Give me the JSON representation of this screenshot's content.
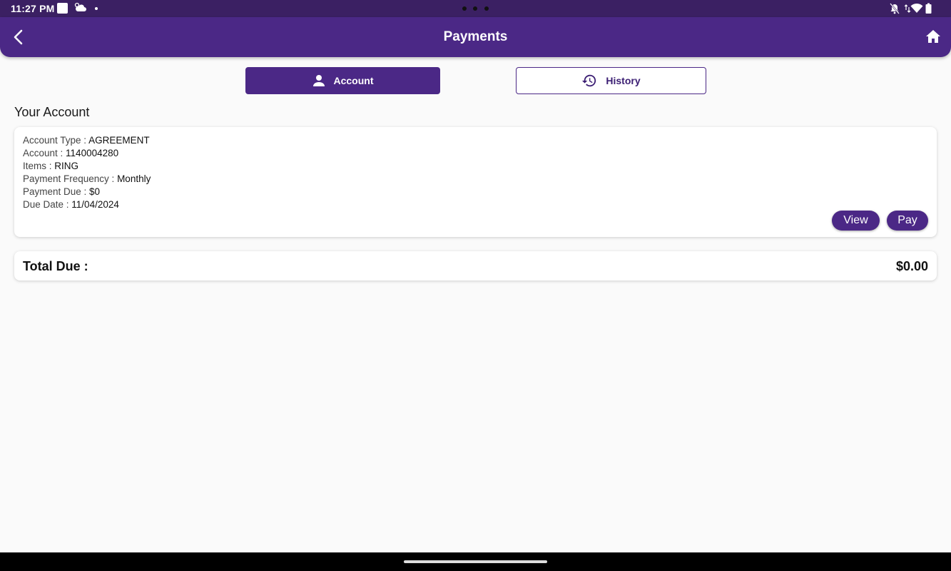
{
  "status_bar": {
    "time": "11:27 PM",
    "icons": [
      "notification-square-icon",
      "cloud-icon",
      "dot-icon",
      "camera-dots",
      "bell-off-icon",
      "data-arrows-icon",
      "wifi-icon",
      "battery-icon"
    ]
  },
  "app_bar": {
    "title": "Payments",
    "back_icon": "back-chevron-icon",
    "home_icon": "home-icon"
  },
  "tabs": [
    {
      "label": "Account",
      "icon": "person-icon",
      "selected": true
    },
    {
      "label": "History",
      "icon": "history-icon",
      "selected": false
    }
  ],
  "section_title": "Your Account",
  "account": {
    "rows": [
      {
        "label": "Account Type : ",
        "value": "AGREEMENT"
      },
      {
        "label": "Account : ",
        "value": "1140004280"
      },
      {
        "label": "Items : ",
        "value": "RING"
      },
      {
        "label": "Payment Frequency : ",
        "value": "Monthly"
      },
      {
        "label": "Payment Due : ",
        "value": "$0"
      },
      {
        "label": "Due Date : ",
        "value": "11/04/2024"
      }
    ],
    "view_label": "View",
    "pay_label": "Pay"
  },
  "total": {
    "label": "Total Due :",
    "value": "$0.00"
  },
  "colors": {
    "primary": "#4b2886",
    "status_bar": "#3b2063",
    "background": "#fafafa"
  }
}
